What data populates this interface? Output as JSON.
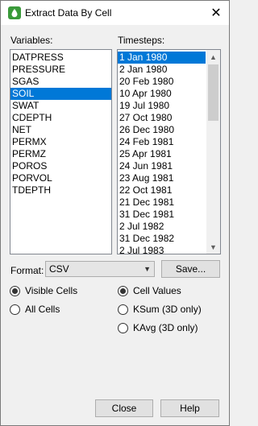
{
  "window": {
    "title": "Extract Data By Cell"
  },
  "variables": {
    "label": "Variables:",
    "items": [
      "DATPRESS",
      "PRESSURE",
      "SGAS",
      "SOIL",
      "SWAT",
      "CDEPTH",
      "NET",
      "PERMX",
      "PERMZ",
      "POROS",
      "PORVOL",
      "TDEPTH"
    ],
    "selected": "SOIL"
  },
  "timesteps": {
    "label": "Timesteps:",
    "items": [
      "1 Jan 1980",
      "2 Jan 1980",
      "20 Feb 1980",
      "10 Apr 1980",
      "19 Jul 1980",
      "27 Oct 1980",
      "26 Dec 1980",
      "24 Feb 1981",
      "25 Apr 1981",
      "24 Jun 1981",
      "23 Aug 1981",
      "22 Oct 1981",
      "21 Dec 1981",
      "31 Dec 1981",
      "2 Jul 1982",
      "31 Dec 1982",
      "2 Jul 1983"
    ],
    "selected": "1 Jan 1980"
  },
  "format": {
    "label": "Format:",
    "value": "CSV"
  },
  "buttons": {
    "save": "Save...",
    "close": "Close",
    "help": "Help"
  },
  "cells_options": {
    "visible": "Visible Cells",
    "all": "All Cells",
    "selected": "Visible Cells"
  },
  "value_options": {
    "cell_values": "Cell Values",
    "ksum": "KSum (3D only)",
    "kavg": "KAvg (3D only)",
    "selected": "Cell Values"
  }
}
